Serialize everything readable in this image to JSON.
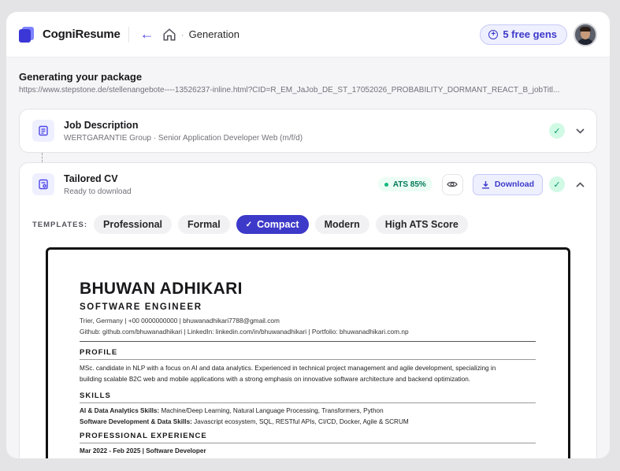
{
  "header": {
    "brand": "CogniResume",
    "breadcrumb": "Generation",
    "free_gens": "5 free gens"
  },
  "main": {
    "title": "Generating your package",
    "url": "https://www.stepstone.de/stellenangebote----13526237-inline.html?CID=R_EM_JaJob_DE_ST_17052026_PROBABILITY_DORMANT_REACT_B_jobTitl..."
  },
  "job_card": {
    "title": "Job Description",
    "subtitle": "WERTGARANTIE Group · Senior Application Developer Web (m/f/d)"
  },
  "cv_card": {
    "title": "Tailored CV",
    "subtitle": "Ready to download",
    "ats": "ATS 85%",
    "download_label": "Download"
  },
  "templates": {
    "label": "TEMPLATES:",
    "options": [
      "Professional",
      "Formal",
      "Compact",
      "Modern",
      "High ATS Score"
    ],
    "selected": "Compact"
  },
  "cv": {
    "name": "BHUWAN ADHIKARI",
    "role": "SOFTWARE ENGINEER",
    "contact1": "Trier, Germany | +00 0000000000 | bhuwanadhikari7788@gmail.com",
    "contact2": "Github: github.com/bhuwanadhikari | LinkedIn: linkedin.com/in/bhuwanadhikari | Portfolio: bhuwanadhikari.com.np",
    "profile_heading": "PROFILE",
    "profile_line1": "MSc. candidate in NLP with a focus on AI and data analytics. Experienced in technical project management and agile development, specializing in",
    "profile_line2": "building scalable B2C web and mobile applications with a strong emphasis on innovative software architecture and backend optimization.",
    "skills_heading": "SKILLS",
    "skill1_label": "AI & Data Analytics Skills:",
    "skill1_value": " Machine/Deep Learning, Natural Language Processing, Transformers, Python",
    "skill2_label": "Software Development & Data Skills:",
    "skill2_value": " Javascript ecosystem, SQL, RESTful APIs, CI/CD, Docker, Agile & SCRUM",
    "experience_heading": "PROFESSIONAL EXPERIENCE",
    "experience_line": "Mar 2022 - Feb 2025 | Software Developer"
  }
}
